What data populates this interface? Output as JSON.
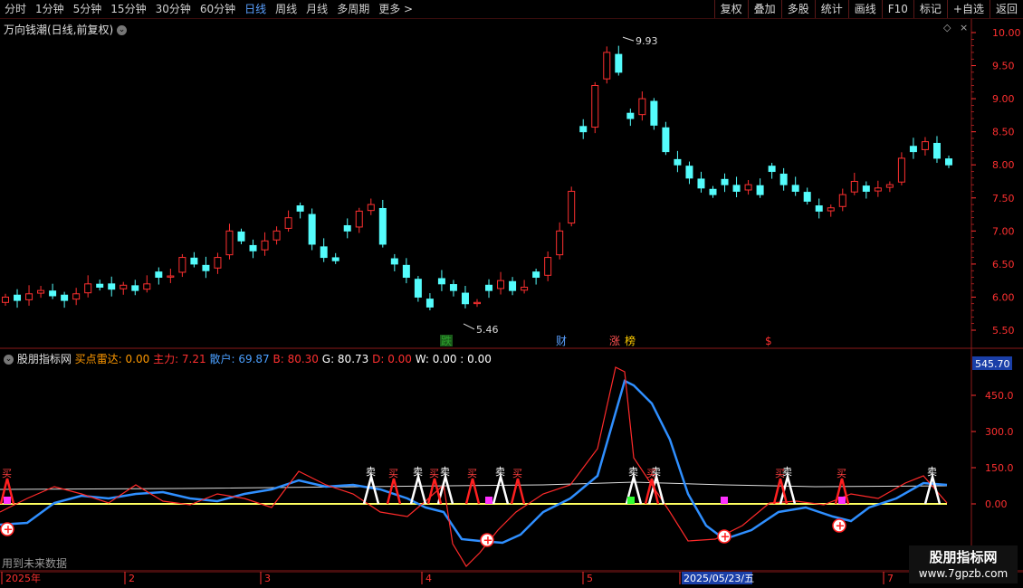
{
  "toolbar": {
    "periods": [
      "分时",
      "1分钟",
      "5分钟",
      "15分钟",
      "30分钟",
      "60分钟",
      "日线",
      "周线",
      "月线",
      "多周期",
      "更多 >"
    ],
    "active_period": "日线",
    "actions": [
      "复权",
      "叠加",
      "多股",
      "统计",
      "画线",
      "F10",
      "标记",
      "+自选",
      "返回"
    ]
  },
  "main_chart": {
    "title": "万向钱潮(日线,前复权)",
    "y_ticks": [
      "10.00",
      "9.50",
      "9.00",
      "8.50",
      "8.00",
      "7.50",
      "7.00",
      "6.50",
      "6.00",
      "5.50"
    ],
    "high_label": "9.93",
    "low_label": "5.46",
    "markers": [
      {
        "text": "跌",
        "color": "#2ca02c",
        "bg": "#1a5a1a"
      },
      {
        "text": "财",
        "color": "#5aa0ff"
      },
      {
        "text": "涨",
        "color": "#ff5050"
      },
      {
        "text": "榜",
        "color": "#ffcc00"
      },
      {
        "text": "$",
        "color": "#ff3030"
      }
    ]
  },
  "indicator": {
    "name": "股朋指标网",
    "items": [
      {
        "label": "买点雷达: 0.00",
        "color": "#ff9900"
      },
      {
        "label": "主力: 7.21",
        "color": "#ff3030"
      },
      {
        "label": "散户: 69.87",
        "color": "#4a9fff"
      },
      {
        "label": "B: 80.30",
        "color": "#ff3030"
      },
      {
        "label": "G: 80.73",
        "color": "#ffffff"
      },
      {
        "label": "D: 0.00",
        "color": "#ff3030"
      },
      {
        "label": "W: 0.00 : 0.00",
        "color": "#ffffff"
      }
    ],
    "y_ticks": [
      "450.0",
      "300.0",
      "150.0",
      "0.00"
    ],
    "current_value": "545.70",
    "sell_label": "卖",
    "buy_label": "买",
    "footer_note": "用到未来数据"
  },
  "timeline": {
    "labels": [
      "2025年",
      "2",
      "3",
      "4",
      "5",
      "2025/05/23/五",
      "7"
    ]
  },
  "watermark": {
    "line1": "股朋指标网",
    "line2": "www.7gpzb.com"
  },
  "colors": {
    "up": "#ff3030",
    "down": "#54fcfc",
    "grid": "#8b1a1a",
    "axis": "#cc2222"
  }
}
